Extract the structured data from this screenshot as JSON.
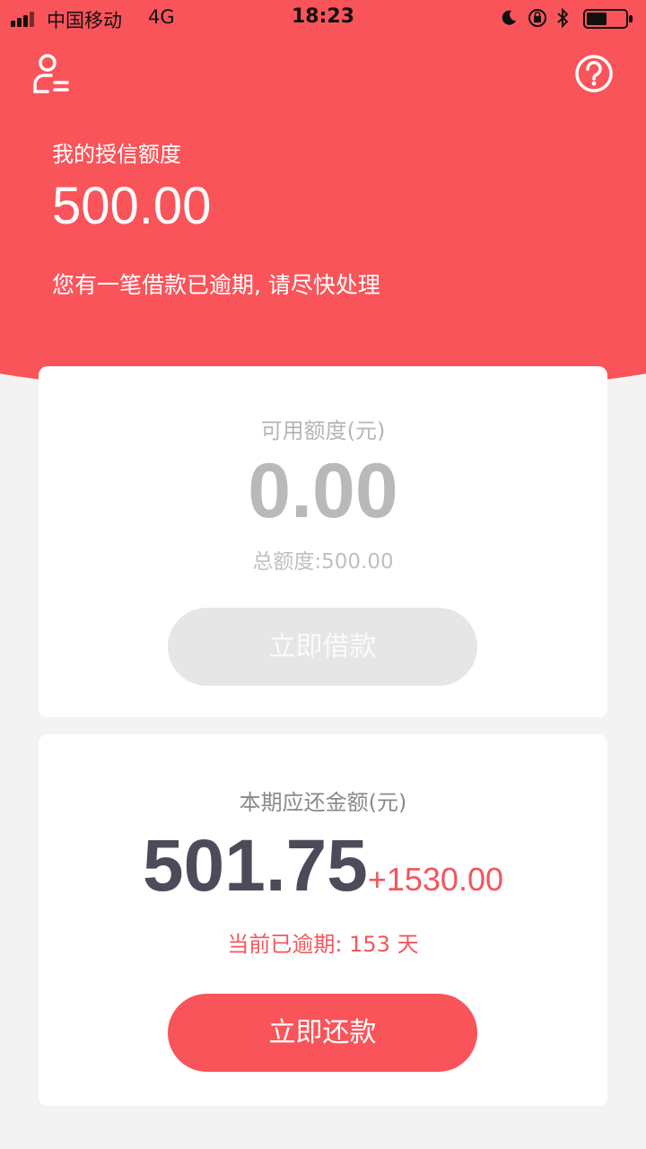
{
  "status_bar": {
    "carrier": "中国移动",
    "network": "4G",
    "time": "18:23"
  },
  "header": {
    "credit_label": "我的授信额度",
    "credit_amount": "500.00",
    "overdue_notice": "您有一笔借款已逾期, 请尽快处理"
  },
  "loan_card": {
    "available_label": "可用额度(元)",
    "available_amount": "0.00",
    "total_quota": "总额度:500.00",
    "borrow_button": "立即借款"
  },
  "repay_card": {
    "due_label": "本期应还金额(元)",
    "due_amount": "501.75",
    "due_extra": "+1530.00",
    "overdue_days": "当前已逾期: 153 天",
    "repay_button": "立即还款"
  },
  "colors": {
    "brand_red": "#f9545a",
    "text_dark": "#4f4a5a",
    "disabled_button": "#e6e6e6"
  },
  "icons": [
    "signal-icon",
    "moon-icon",
    "rotation-lock-icon",
    "bluetooth-icon",
    "battery-icon",
    "user-icon",
    "help-icon"
  ]
}
